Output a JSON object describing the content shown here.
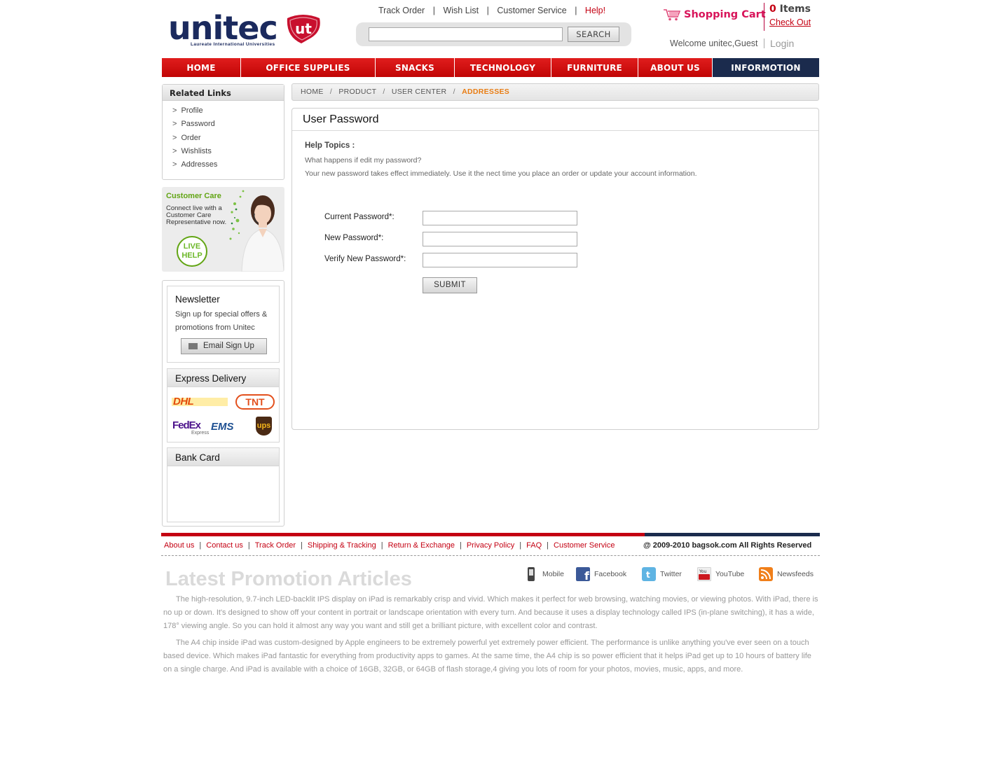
{
  "logo": {
    "word": "unitec",
    "subtitle": "Laureate International Universities"
  },
  "top_links": {
    "track_order": "Track Order",
    "wish_list": "Wish List",
    "customer_service": "Customer Service",
    "help": "Help!",
    "sep": "|"
  },
  "search": {
    "button": "SEARCH",
    "value": ""
  },
  "cart": {
    "label": "Shopping Cart",
    "count": "0",
    "items_word": "Items",
    "checkout": "Check Out"
  },
  "user": {
    "welcome": "Welcome unitec,Guest",
    "login": "Login"
  },
  "nav": [
    {
      "label": "HOME"
    },
    {
      "label": "OFFICE SUPPLIES"
    },
    {
      "label": "SNACKS"
    },
    {
      "label": "TECHNOLOGY"
    },
    {
      "label": "FURNITURE"
    },
    {
      "label": "ABOUT US"
    },
    {
      "label": "INFORMOTION"
    }
  ],
  "sidebar": {
    "related_title": "Related Links",
    "related_links": [
      "Profile",
      "Password",
      "Order",
      "Wishlists",
      "Addresses"
    ],
    "chevron": ">",
    "customer_care": {
      "title": "Customer Care",
      "text": "Connect live with a Customer Care Representative now.",
      "live": "LIVE",
      "help": "HELP"
    },
    "newsletter": {
      "title": "Newsletter",
      "text": "Sign up for special offers & promotions from Unitec",
      "button": "Email Sign Up"
    },
    "express": {
      "title": "Express Delivery",
      "carriers": [
        "DHL",
        "TNT",
        "FedEx",
        "EMS",
        "ups"
      ],
      "fedex_sub": "Express"
    },
    "bank": {
      "title": "Bank Card"
    }
  },
  "breadcrumb": {
    "items": [
      "HOME",
      "PRODUCT",
      "USER CENTER"
    ],
    "current": "ADDRESSES",
    "sep": "/"
  },
  "main": {
    "title": "User Password",
    "help_topics": "Help Topics :",
    "question": "What happens if edit my password?",
    "answer": "Your new password takes effect immediately. Use it the nect time you place an order or update your account information.",
    "fields": {
      "current": "Current Password*:",
      "new": "New Password*:",
      "verify": "Verify New Password*:"
    },
    "submit": "SUBMIT"
  },
  "footer": {
    "links": [
      "About us",
      "Contact us",
      "Track Order",
      "Shipping & Tracking",
      "Return & Exchange",
      "Privacy Policy",
      "FAQ",
      "Customer Service"
    ],
    "copyright": "@ 2009-2010 bagsok.com  All Rights Reserved",
    "promo_title": "Latest Promotion Articles",
    "social": [
      "Mobile",
      "Facebook",
      "Twitter",
      "YouTube",
      "Newsfeeds"
    ],
    "paragraphs": [
      "The high-resolution, 9.7-inch LED-backlit IPS display on iPad is remarkably crisp and vivid. Which makes it perfect for web browsing, watching movies, or viewing photos. With iPad, there is no up or down. It's designed to show off your content in portrait or landscape orientation with every turn. And because it uses a display technology called IPS (in-plane switching), it has a wide, 178° viewing angle. So you can hold it almost any way you want and still get a brilliant picture, with excellent color and contrast.",
      "The A4 chip inside iPad was custom-designed by Apple engineers to be extremely powerful yet extremely power efficient. The performance is unlike anything you've ever seen on a touch based device. Which makes iPad fantastic for everything from productivity apps to games. At the same time, the A4 chip is so power efficient that it helps iPad get up to 10 hours of battery life on a single charge. And iPad is available with a choice of 16GB, 32GB, or 64GB of flash storage,4 giving you lots of room for your photos, movies, music, apps, and more."
    ]
  },
  "colors": {
    "brand_red": "#c40012",
    "brand_navy": "#1b2b4d",
    "cart_pink": "#d8145a",
    "care_green": "#62a514",
    "crumb_orange": "#e87c12"
  }
}
